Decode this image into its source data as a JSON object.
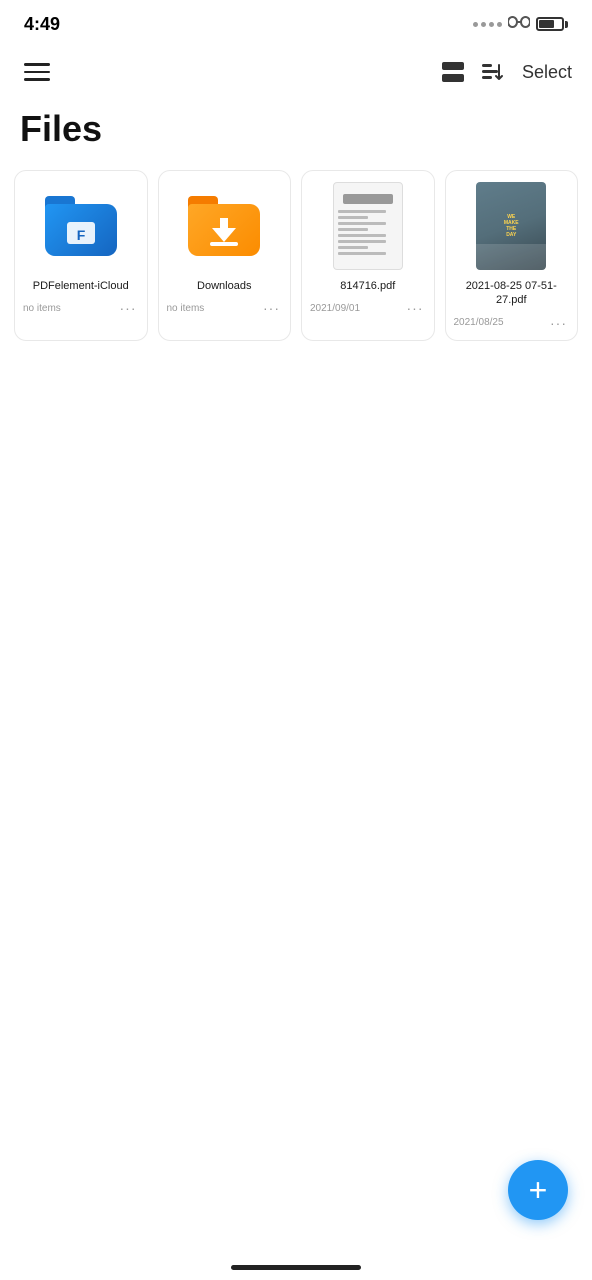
{
  "statusBar": {
    "time": "4:49",
    "batteryLevel": 70
  },
  "navBar": {
    "selectLabel": "Select"
  },
  "page": {
    "title": "Files"
  },
  "files": [
    {
      "id": "pdfcloud",
      "name": "PDFelement-iCloud",
      "type": "folder-icloud",
      "meta": "no items",
      "date": ""
    },
    {
      "id": "downloads",
      "name": "Downloads",
      "type": "folder-downloads",
      "meta": "no items",
      "date": ""
    },
    {
      "id": "pdf814716",
      "name": "814716.pdf",
      "type": "pdf",
      "meta": "",
      "date": "2021/09/01"
    },
    {
      "id": "pdf2021",
      "name": "2021-08-25 07-51-27.pdf",
      "type": "image",
      "meta": "",
      "date": "2021/08/25"
    }
  ],
  "fab": {
    "label": "+"
  }
}
